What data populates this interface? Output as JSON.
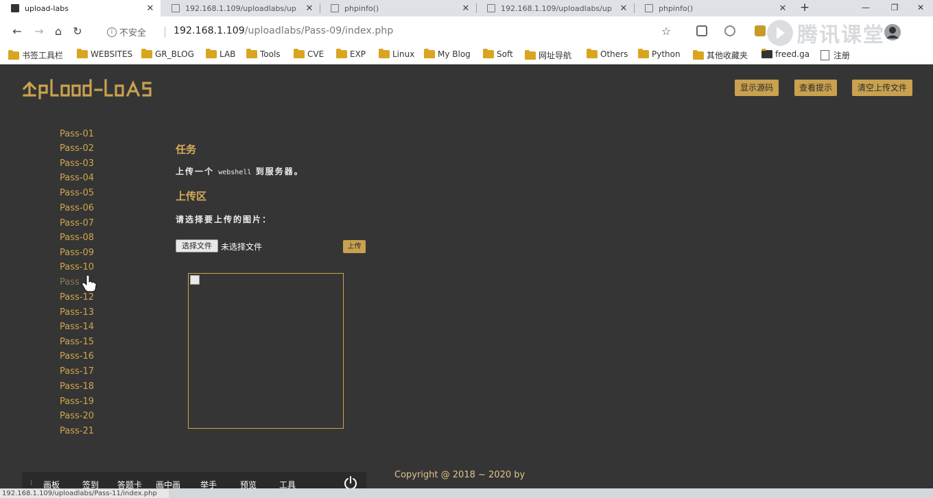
{
  "browser": {
    "tabs": [
      {
        "title": "upload-labs",
        "active": true
      },
      {
        "title": "192.168.1.109/uploadlabs/up",
        "active": false
      },
      {
        "title": "phpinfo()",
        "active": false
      },
      {
        "title": "192.168.1.109/uploadlabs/up",
        "active": false
      },
      {
        "title": "phpinfo()",
        "active": false
      }
    ],
    "security_label": "不安全",
    "url_host": "192.168.1.109",
    "url_path": "/uploadlabs/Pass-09/index.php",
    "watermark_text": "腾讯课堂",
    "bookmarks": [
      {
        "label": "书签工具栏"
      },
      {
        "label": "WEBSITES"
      },
      {
        "label": "GR_BLOG"
      },
      {
        "label": "LAB"
      },
      {
        "label": "Tools"
      },
      {
        "label": "CVE"
      },
      {
        "label": "EXP"
      },
      {
        "label": "Linux"
      },
      {
        "label": "My Blog"
      },
      {
        "label": "Soft"
      },
      {
        "label": "网址导航"
      },
      {
        "label": "Others"
      },
      {
        "label": "Python"
      },
      {
        "label": "其他收藏夹"
      },
      {
        "label": "freed.ga"
      },
      {
        "label": "注册"
      }
    ]
  },
  "header": {
    "buttons": {
      "show_source": "显示源码",
      "view_hint": "查看提示",
      "clear_uploads": "清空上传文件"
    }
  },
  "menu": {
    "items": [
      "Pass-01",
      "Pass-02",
      "Pass-03",
      "Pass-04",
      "Pass-05",
      "Pass-06",
      "Pass-07",
      "Pass-08",
      "Pass-09",
      "Pass-10",
      "Pass",
      "Pass-12",
      "Pass-13",
      "Pass-14",
      "Pass-15",
      "Pass-16",
      "Pass-17",
      "Pass-18",
      "Pass-19",
      "Pass-20",
      "Pass-21"
    ]
  },
  "main": {
    "task_heading": "任务",
    "task_text_before": "上传一个",
    "task_text_code": "webshell",
    "task_text_after": "到服务器。",
    "upload_heading": "上传区",
    "choose_label": "请选择要上传的图片：",
    "file_button": "选择文件",
    "no_file": "未选择文件",
    "upload_button": "上传"
  },
  "footer": {
    "copyright": "Copyright @ 2018 ~ 2020 by"
  },
  "overlay": {
    "toolbar_items": [
      "画板",
      "签到",
      "答题卡",
      "画中画",
      "举手",
      "预览",
      "工具"
    ],
    "status_url": "192.168.1.109/uploadlabs/Pass-11/index.php"
  }
}
